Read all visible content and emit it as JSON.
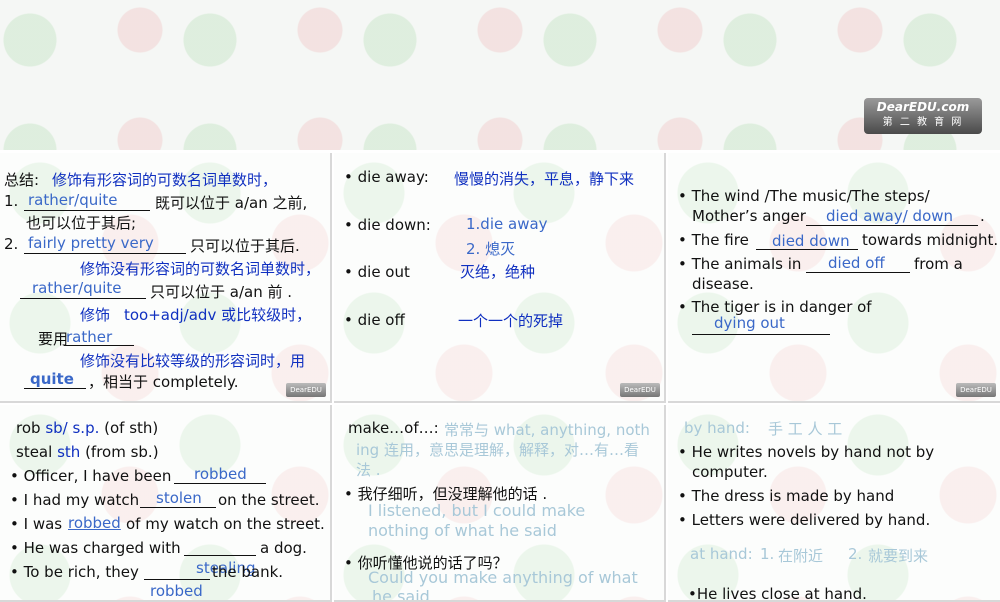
{
  "banner": {
    "logo_line1": "DearEDU.com",
    "logo_line2": "第 二 教 育 网"
  },
  "s1": {
    "summary_label": "总结:",
    "summary_text": "修饰有形容词的可数名词单数时，",
    "item1_num": "1.",
    "item1_ans": "rather/quite",
    "item1_text": "既可以位于 a/an 之前,",
    "item1_text2": "也可以位于其后;",
    "item2_num": "2.",
    "item2_ans": "fairly pretty very",
    "item2_text": "只可以位于其后.",
    "line3": "修饰没有形容词的可数名词单数时，",
    "line4_ans": "rather/quite",
    "line4_text": "只可以位于 a/an 前 .",
    "line5_a": "修饰",
    "line5_b": "too+adj/adv 或比较级时，",
    "line6_a": "要用",
    "line6_ans": "rather",
    "line7": "修饰没有比较等级的形容词时，用",
    "line8_ans": "quite",
    "line8_text": "，相当于 completely."
  },
  "s2": {
    "r1_term": "die away:",
    "r1_def": "慢慢的消失，平息，静下来",
    "r2_term": "die down:",
    "r2_ans1": "1.die away",
    "r2_ans2": "2. 熄灭",
    "r3_term": "die out",
    "r3_def": "灭绝，绝种",
    "r4_term": "die off",
    "r4_def": "一个一个的死掉"
  },
  "s3": {
    "b1_line1": "The wind  /The music/The steps/",
    "b1_line2": "Mother’s anger",
    "b1_ans": "died away/ down",
    "b2_a": "The fire",
    "b2_ans": "died down",
    "b2_b": "towards midnight.",
    "b3_a": "The animals in",
    "b3_ans": "died off",
    "b3_b": "from a",
    "b3_c": "disease.",
    "b4_line1": "The tiger is in danger of",
    "b4_ans": "dying out"
  },
  "s4": {
    "h1_a": "rob",
    "h1_b": "sb/ s.p.",
    "h1_c": "(of sth)",
    "h2_a": "steal",
    "h2_b": "sth",
    "h2_c": "(from sb.)",
    "l1_a": "Officer, I have been",
    "l1_ans": "robbed",
    "l2_a": "I had my watch",
    "l2_ans": "stolen",
    "l2_b": "on the street.",
    "l3_a": "I was",
    "l3_ans": "robbed",
    "l3_b": "of my watch on the street.",
    "l4_a": "He was charged with",
    "l4_b": "a dog.",
    "l5_a": "To be rich, they",
    "l5_ans": "stealing",
    "l5_b": "the bank.",
    "l5_ans2": "robbed"
  },
  "s5": {
    "h_a": "make…of…:",
    "h_b": "常常与  what, anything,  noth",
    "h_c": "ing  连用，意思是理解，解释，对…有…看",
    "h_d": "法 .",
    "q1": "我仔细听，但没理解他的话 .",
    "q1_ans1": "I listened, but I could make",
    "q1_ans2": "nothing of what he said",
    "q2": "你听懂他说的话了吗？",
    "q2_ans1": "Could you make anything of what",
    "q2_ans2": "he said"
  },
  "s6": {
    "h_a": "by hand:",
    "h_b": "手 工  人 工",
    "b1_line1": "He writes novels by hand not by",
    "b1_line2": "computer.",
    "b2": "The dress is made by hand",
    "b3": "Letters were delivered by hand.",
    "ah_a": "at hand:",
    "ah_b": "1.",
    "ah_c": "在附近",
    "ah_d": "2.",
    "ah_e": "就要到来",
    "last": "He lives close at hand."
  },
  "footer_logo": "DearEDU"
}
